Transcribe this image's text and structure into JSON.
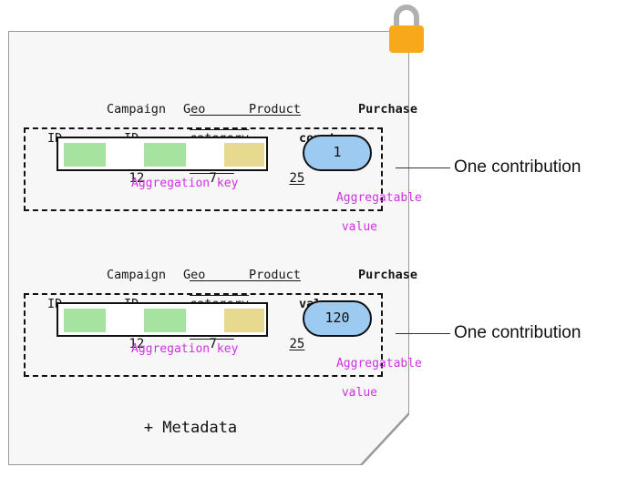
{
  "card": {
    "icon": "padlock-icon",
    "lock_body_color": "#f7a81b",
    "lock_shackle_color": "#b0b0b0",
    "background_color": "#f7f7f7",
    "border_color": "#9a9a9a",
    "metadata_label": "+ Metadata"
  },
  "colors": {
    "key_chip_green": "#a7e3a0",
    "key_chip_yellow": "#e7d98d",
    "value_pill_blue": "#9dcaf1",
    "annotation_magenta": "#cc33e0",
    "stroke_black": "#111111"
  },
  "contributions": [
    {
      "headers": {
        "campaign": {
          "line1": "Campaign",
          "line2": "ID"
        },
        "geo": {
          "line1": "Geo",
          "line2": "ID"
        },
        "product": {
          "line1": "Product",
          "line2": "category"
        },
        "measure": {
          "line1": "Purchase",
          "line2": "count"
        }
      },
      "aggregation_key": {
        "campaign_id": "12",
        "geo_id": "7",
        "product_category": "25"
      },
      "aggregatable_value": "1",
      "key_label": "Aggregation key",
      "value_label": {
        "line1": "Aggregatable",
        "line2": "value"
      },
      "annotation": "One contribution"
    },
    {
      "headers": {
        "campaign": {
          "line1": "Campaign",
          "line2": "ID"
        },
        "geo": {
          "line1": "Geo",
          "line2": "ID"
        },
        "product": {
          "line1": "Product",
          "line2": "category"
        },
        "measure": {
          "line1": "Purchase",
          "line2": "value"
        }
      },
      "aggregation_key": {
        "campaign_id": "12",
        "geo_id": "7",
        "product_category": "25"
      },
      "aggregatable_value": "120",
      "key_label": "Aggregation key",
      "value_label": {
        "line1": "Aggregatable",
        "line2": "value"
      },
      "annotation": "One contribution"
    }
  ]
}
